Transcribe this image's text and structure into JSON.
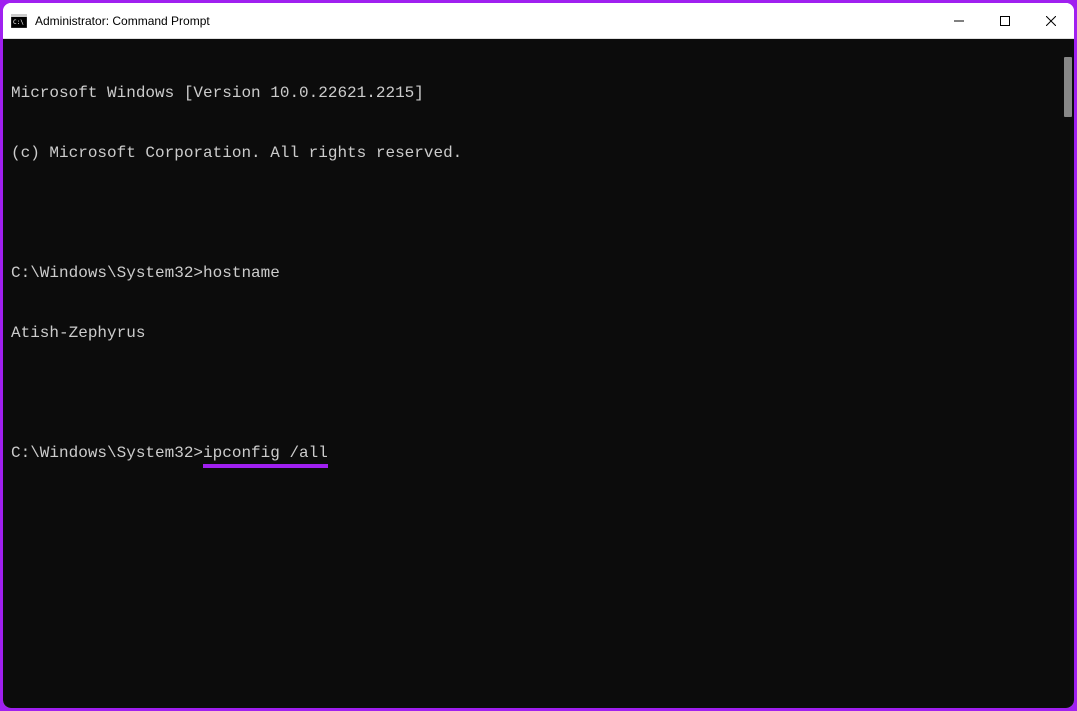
{
  "window": {
    "title": "Administrator: Command Prompt"
  },
  "terminal": {
    "lines": [
      "Microsoft Windows [Version 10.0.22621.2215]",
      "(c) Microsoft Corporation. All rights reserved.",
      "",
      "C:\\Windows\\System32>hostname",
      "Atish-Zephyrus",
      ""
    ],
    "prompt_line": {
      "prompt": "C:\\Windows\\System32>",
      "command": "ipconfig /all"
    }
  },
  "colors": {
    "accent": "#a020f0",
    "terminal_bg": "#0c0c0c",
    "terminal_fg": "#cccccc"
  }
}
